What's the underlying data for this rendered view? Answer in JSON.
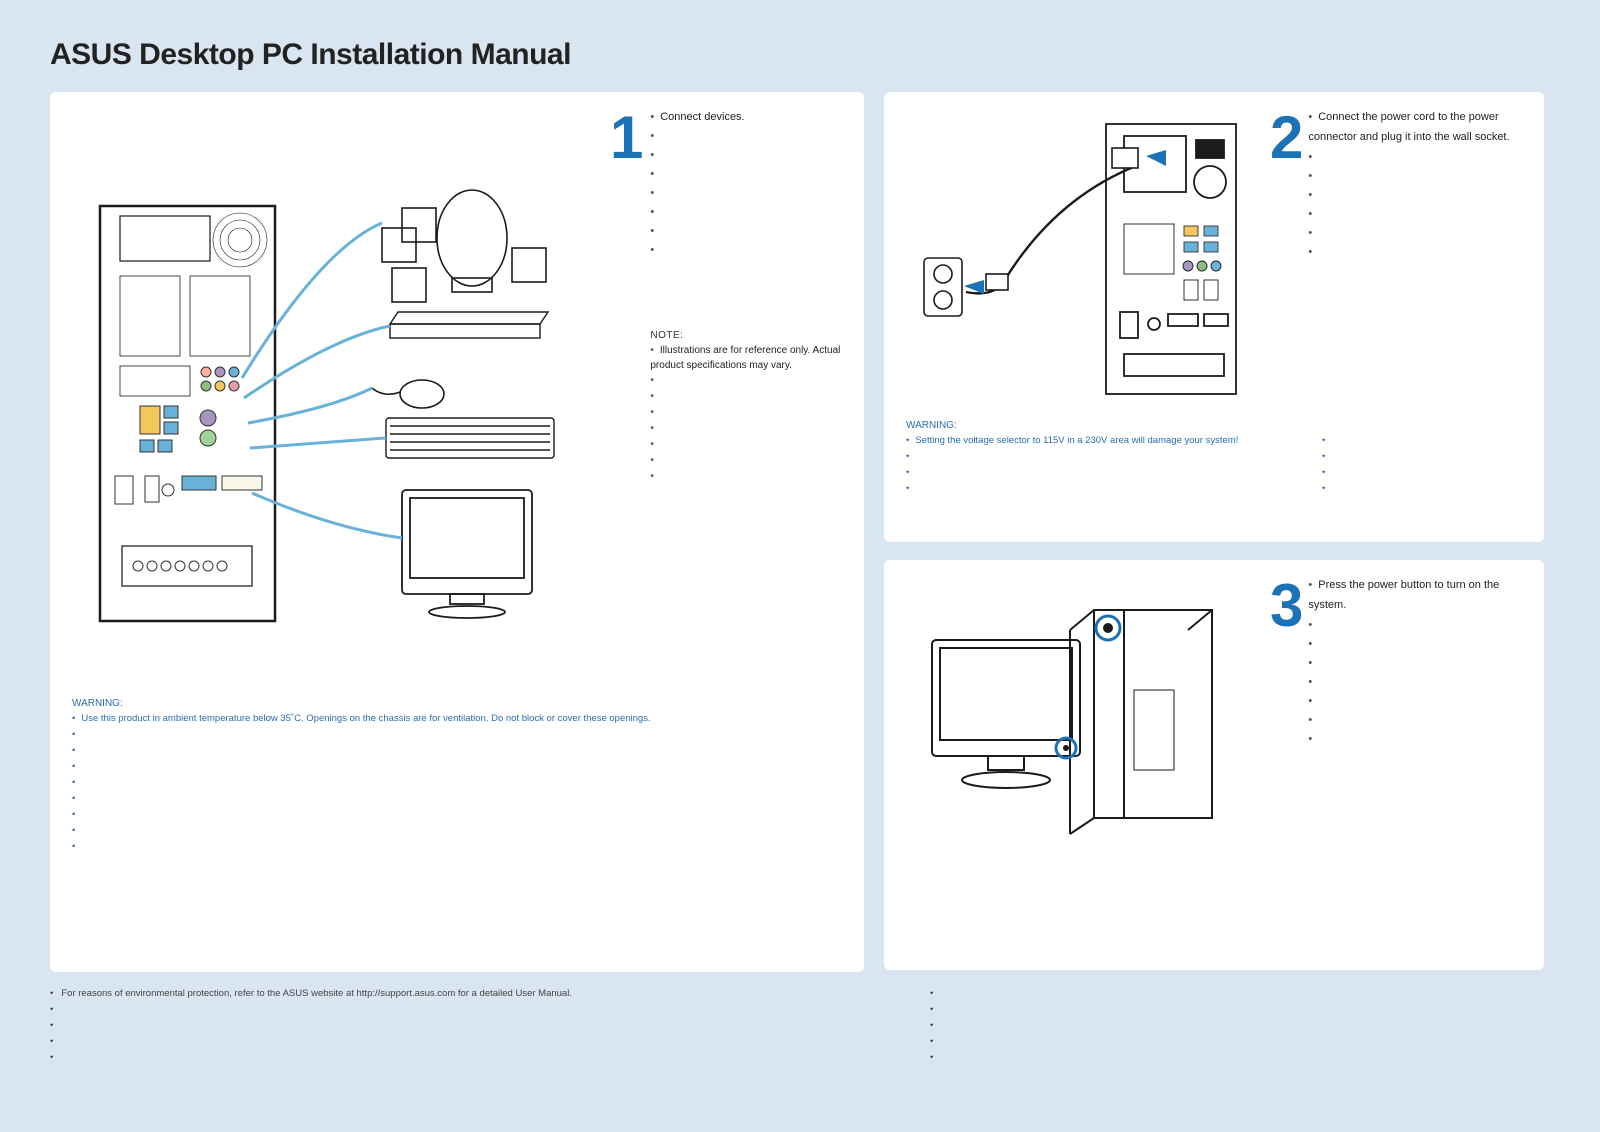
{
  "title": "ASUS Desktop PC Installation Manual",
  "steps": {
    "s1": {
      "num": "1",
      "instructions": [
        "Connect devices.",
        "",
        "",
        "",
        "",
        "",
        "",
        ""
      ],
      "note_head": "NOTE:",
      "notes": [
        "Illustrations are for reference only. Actual product specifications may vary.",
        "",
        "",
        "",
        "",
        "",
        "",
        ""
      ],
      "warn_head": "WARNING:",
      "warns": [
        "Use this product in ambient temperature below 35˚C. Openings on the chassis are for ventilation. Do not block or cover these openings.",
        "",
        "",
        "",
        "",
        "",
        "",
        "",
        ""
      ]
    },
    "s2": {
      "num": "2",
      "instructions": [
        "Connect the power cord to the power connector and plug  it into the wall socket.",
        "",
        "",
        "",
        "",
        "",
        ""
      ],
      "warn_head": "WARNING:",
      "warns_left": [
        "Setting the voltage selector to 115V in a 230V area will damage your system!",
        "",
        "",
        ""
      ],
      "warns_right": [
        "",
        "",
        "",
        ""
      ]
    },
    "s3": {
      "num": "3",
      "instructions": [
        "Press the power button to turn on the system.",
        "",
        "",
        "",
        "",
        "",
        "",
        ""
      ]
    }
  },
  "footer": {
    "left": [
      "For reasons of environmental protection, refer to the ASUS website at http://support.asus.com for a detailed User Manual.",
      "",
      "",
      "",
      ""
    ],
    "right": [
      "",
      "",
      "",
      "",
      ""
    ]
  }
}
